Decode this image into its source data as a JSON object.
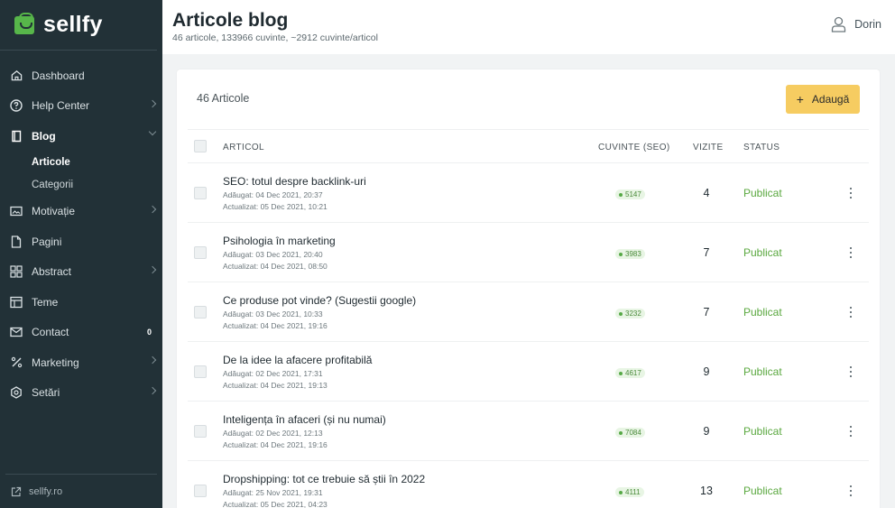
{
  "brand": {
    "name": "sellfy"
  },
  "sidebar": {
    "items": [
      {
        "label": "Dashboard",
        "icon": "home-icon"
      },
      {
        "label": "Help Center",
        "icon": "help-circle-icon"
      },
      {
        "label": "Blog",
        "icon": "book-icon",
        "expanded": true
      },
      {
        "label": "Motivație",
        "icon": "media-icon"
      },
      {
        "label": "Pagini",
        "icon": "file-icon"
      },
      {
        "label": "Abstract",
        "icon": "layout-icon"
      },
      {
        "label": "Teme",
        "icon": "template-icon"
      },
      {
        "label": "Contact",
        "icon": "mail-icon",
        "count": "0"
      },
      {
        "label": "Marketing",
        "icon": "percent-icon"
      },
      {
        "label": "Setări",
        "icon": "settings-icon"
      }
    ],
    "blog_sub": [
      {
        "label": "Articole",
        "active": true
      },
      {
        "label": "Categorii"
      }
    ],
    "footer_link": "sellfy.ro"
  },
  "header": {
    "title": "Articole blog",
    "subtitle": "46 articole, 133966 cuvinte, ~2912 cuvinte/articol",
    "user": "Dorin"
  },
  "main": {
    "count_label": "46 Articole",
    "add_label": "Adaugă",
    "columns": {
      "article": "ARTICOL",
      "words": "CUVINTE (SEO)",
      "visits": "VIZITE",
      "status": "STATUS"
    },
    "rows": [
      {
        "title": "SEO: totul despre backlink-uri",
        "added": "Adăugat: 04 Dec 2021, 20:37",
        "updated": "Actualizat: 05 Dec 2021, 10:21",
        "words": "5147",
        "visits": "4",
        "status": "Publicat"
      },
      {
        "title": "Psihologia în marketing",
        "added": "Adăugat: 03 Dec 2021, 20:40",
        "updated": "Actualizat: 04 Dec 2021, 08:50",
        "words": "3983",
        "visits": "7",
        "status": "Publicat"
      },
      {
        "title": "Ce produse pot vinde? (Sugestii google)",
        "added": "Adăugat: 03 Dec 2021, 10:33",
        "updated": "Actualizat: 04 Dec 2021, 19:16",
        "words": "3232",
        "visits": "7",
        "status": "Publicat"
      },
      {
        "title": "De la idee la afacere profitabilă",
        "added": "Adăugat: 02 Dec 2021, 17:31",
        "updated": "Actualizat: 04 Dec 2021, 19:13",
        "words": "4617",
        "visits": "9",
        "status": "Publicat"
      },
      {
        "title": "Inteligența în afaceri (și nu numai)",
        "added": "Adăugat: 02 Dec 2021, 12:13",
        "updated": "Actualizat: 04 Dec 2021, 19:16",
        "words": "7084",
        "visits": "9",
        "status": "Publicat"
      },
      {
        "title": "Dropshipping: tot ce trebuie să știi în 2022",
        "added": "Adăugat: 25 Nov 2021, 19:31",
        "updated": "Actualizat: 05 Dec 2021, 04:23",
        "words": "4111",
        "visits": "13",
        "status": "Publicat"
      }
    ]
  },
  "colors": {
    "sidebar_bg": "#223137",
    "brand_green": "#57b64a",
    "accent_yellow": "#f6cc61",
    "status_green": "#5aa83f"
  }
}
